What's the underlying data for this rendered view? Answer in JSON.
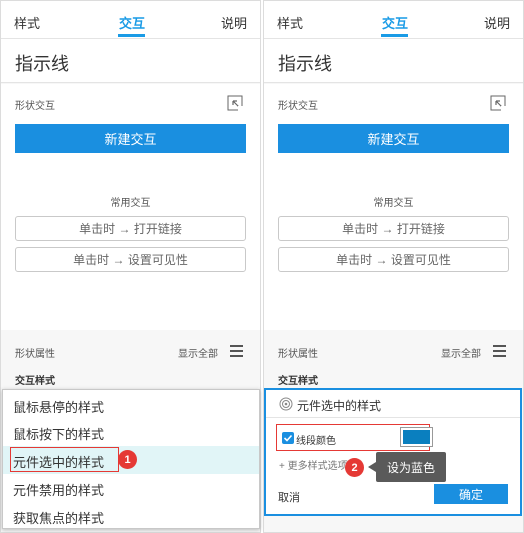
{
  "tabs": [
    "样式",
    "交互",
    "说明"
  ],
  "title": "指示线",
  "shape_interaction": {
    "label": "形状交互",
    "new_button": "新建交互",
    "common_label": "常用交互",
    "common_actions": [
      "单击时 → 打开链接",
      "单击时 → 设置可见性"
    ]
  },
  "shape_properties": {
    "label": "形状属性",
    "show_all": "显示全部"
  },
  "interaction_style_label": "交互样式",
  "dropdown": {
    "items": [
      "鼠标悬停的样式",
      "鼠标按下的样式",
      "元件选中的样式",
      "元件禁用的样式",
      "获取焦点的样式"
    ],
    "highlighted_index": 2,
    "badge": "1"
  },
  "editor": {
    "title": "元件选中的样式",
    "line_color_label": "线段颜色",
    "line_color_checked": true,
    "line_color_value": "#0a7fbf",
    "more_styles": "+ 更多样式选项",
    "badge": "2",
    "tooltip": "设为蓝色",
    "cancel": "取消",
    "confirm": "确定"
  },
  "colors": {
    "accent": "#1a8fe0",
    "annotation_red": "#e53935",
    "highlight_bg": "#e1f5f7"
  }
}
